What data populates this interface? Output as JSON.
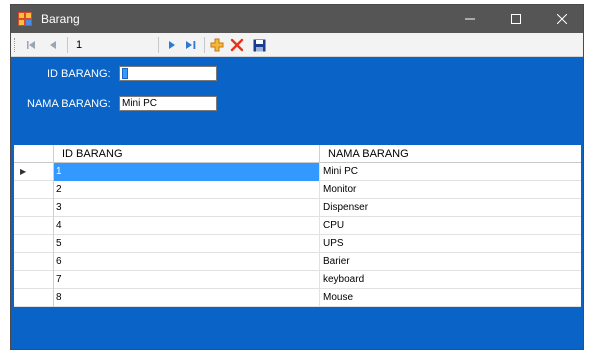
{
  "window": {
    "title": "Barang",
    "controls": {
      "minimize": "—",
      "maximize": "☐",
      "close": "✕"
    }
  },
  "toolbar": {
    "position": "1",
    "count_label": "",
    "icons": {
      "first": "first-record-icon",
      "prev": "previous-record-icon",
      "next": "next-record-icon",
      "last": "last-record-icon",
      "add": "add-icon",
      "delete": "delete-icon",
      "save": "save-icon"
    }
  },
  "form": {
    "id_label": "ID BARANG:",
    "id_value": "1",
    "nama_label": "NAMA BARANG:",
    "nama_value": "Mini PC"
  },
  "grid": {
    "columns": [
      "ID BARANG",
      "NAMA BARANG"
    ],
    "rows": [
      {
        "id": "1",
        "nama": "Mini PC",
        "current": true
      },
      {
        "id": "2",
        "nama": "Monitor"
      },
      {
        "id": "3",
        "nama": "Dispenser"
      },
      {
        "id": "4",
        "nama": "CPU"
      },
      {
        "id": "5",
        "nama": "UPS"
      },
      {
        "id": "6",
        "nama": "Barier"
      },
      {
        "id": "7",
        "nama": "keyboard"
      },
      {
        "id": "8",
        "nama": "Mouse"
      }
    ]
  },
  "colors": {
    "form_background": "#0a64c8",
    "titlebar": "#555555",
    "selection": "#3399ff",
    "add_icon": "#f0a020",
    "delete_icon": "#e8331c",
    "nav_icon": "#2a7ad6",
    "save_icon": "#1a3d8f"
  }
}
